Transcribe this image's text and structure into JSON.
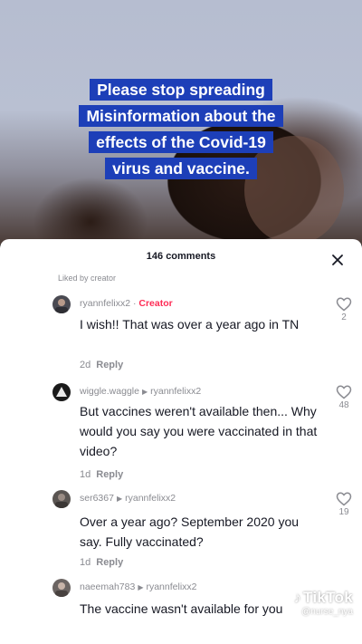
{
  "video": {
    "caption_lines": [
      "Please stop spreading",
      "Misinformation about the",
      "effects of the Covid-19",
      "virus and vaccine."
    ]
  },
  "comments_sheet": {
    "count_label": "146 comments",
    "liked_by_label": "Liked by creator",
    "comments": [
      {
        "username": "ryannfelixx2",
        "creator_badge": "Creator",
        "reply_to": "",
        "text": "I wish!! That was over a year ago in TN",
        "age": "2d",
        "reply_label": "Reply",
        "likes": "2"
      },
      {
        "username": "wiggle.waggle",
        "creator_badge": "",
        "reply_to": "ryannfelixx2",
        "text": "But vaccines weren't available then... Why would you say you were vaccinated in that video?",
        "age": "1d",
        "reply_label": "Reply",
        "likes": "48"
      },
      {
        "username": "ser6367",
        "creator_badge": "",
        "reply_to": "ryannfelixx2",
        "text": "Over a year ago? September 2020 you say. Fully vaccinated?",
        "age": "1d",
        "reply_label": "Reply",
        "likes": "19"
      },
      {
        "username": "naeemah783",
        "creator_badge": "",
        "reply_to": "ryannfelixx2",
        "text": "The vaccine wasn't available for you",
        "age": "",
        "reply_label": "",
        "likes": ""
      }
    ]
  },
  "watermark": {
    "logo": "TikTok",
    "handle": "@nurse_nya"
  },
  "colors": {
    "caption_bg": "#1d3fb8",
    "creator_accent": "#fe2c55",
    "muted_text": "#8a8b91"
  }
}
